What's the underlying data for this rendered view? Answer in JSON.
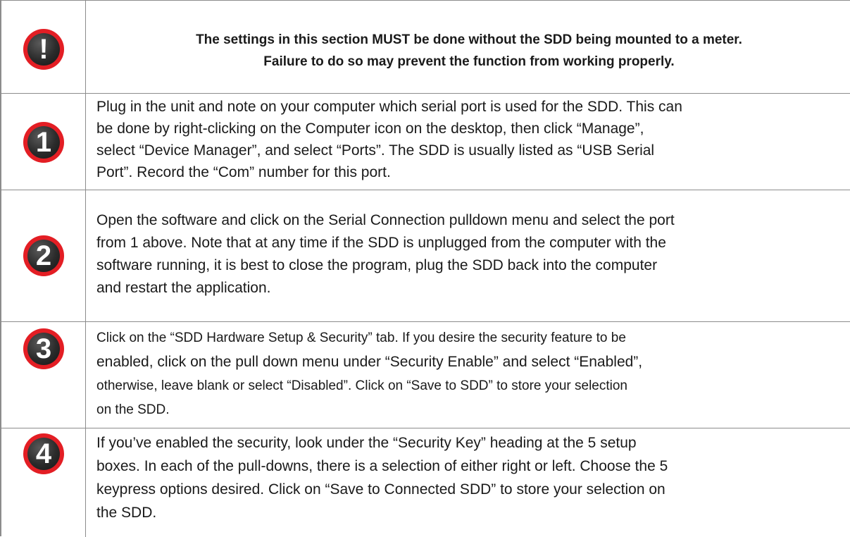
{
  "warning": {
    "icon": "exclamation-icon",
    "lines": [
      "The settings in this section MUST be done without the SDD being mounted to a meter.",
      "Failure to do so may prevent the function from working properly."
    ]
  },
  "steps": [
    {
      "number": "1",
      "icon": "step-1-icon",
      "lines": [
        "Plug in the unit and note on your computer which serial port is used for the SDD. This can",
        "be done by right-clicking on the Computer icon on the desktop, then click “Manage”,",
        "select “Device Manager”, and select “Ports”. The SDD is usually listed as “USB Serial",
        "Port”. Record the “Com” number for this port."
      ]
    },
    {
      "number": "2",
      "icon": "step-2-icon",
      "lines": [
        "Open the software and click on the Serial Connection pulldown menu and select the port",
        "from 1 above. Note that at any time if the SDD is unplugged from the computer with the",
        "software running, it is best to close the program, plug the SDD back into the computer",
        "and restart the application."
      ]
    },
    {
      "number": "3",
      "icon": "step-3-icon",
      "lines": [
        "Click on the “SDD Hardware Setup & Security” tab. If you desire the security feature to be",
        "enabled, click on the pull down menu under “Security Enable” and select “Enabled”,",
        "otherwise, leave blank or select “Disabled”. Click on “Save to SDD” to store your selection",
        "on the SDD."
      ]
    },
    {
      "number": "4",
      "icon": "step-4-icon",
      "lines": [
        "If you’ve enabled the security, look under the “Security Key” heading at the 5 setup",
        "boxes. In each of the pull-downs, there is a selection of either right or left. Choose the 5",
        "keypress options desired. Click on “Save to Connected SDD” to store your selection on",
        "the SDD."
      ]
    }
  ],
  "colors": {
    "badge_ring": "#e31e24",
    "badge_fill": "#2b2b2b",
    "border": "#8c8c8c"
  }
}
